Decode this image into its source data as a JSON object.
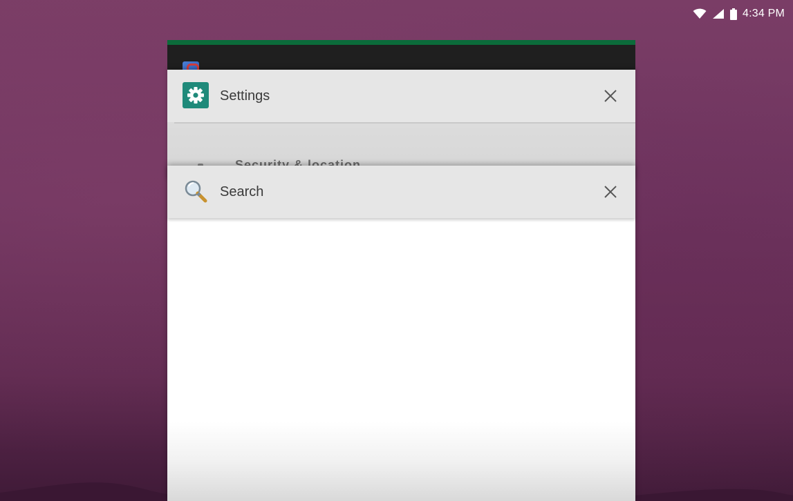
{
  "status_bar": {
    "time": "4:34 PM",
    "icons": [
      "wifi-icon",
      "cell-signal-icon",
      "battery-icon"
    ]
  },
  "recents": {
    "back_card": {
      "icon": "app-icon",
      "accent_color": "#0b6b3a"
    },
    "settings_card": {
      "title": "Settings",
      "icon": "gear-icon",
      "icon_color": "#1f8a7a",
      "close_icon": "close-icon",
      "visible_row": "Security & location"
    },
    "search_card": {
      "title": "Search",
      "icon": "magnifier-icon",
      "close_icon": "close-icon"
    }
  },
  "colors": {
    "wallpaper": "#6f3560",
    "card_header": "#e6e6e6"
  }
}
